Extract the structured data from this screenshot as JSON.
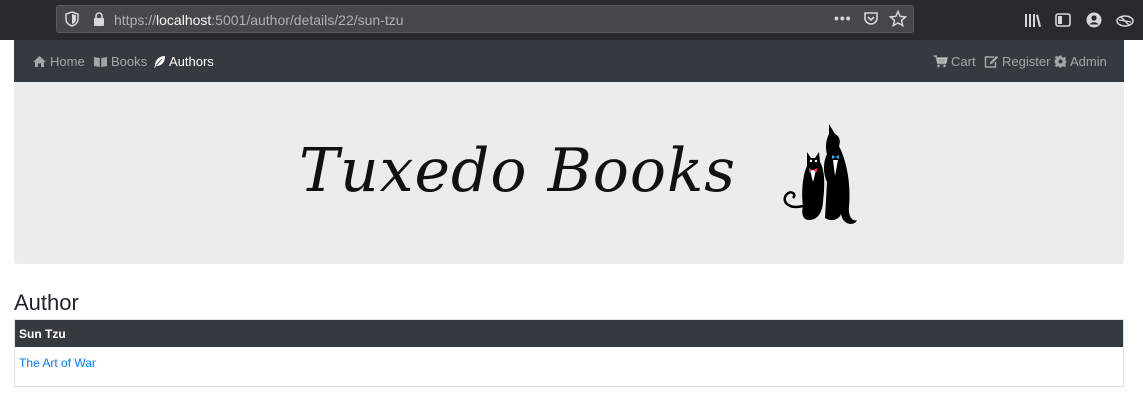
{
  "browser": {
    "url_scheme": "https://",
    "url_host": "localhost",
    "url_path": ":5001/author/details/22/sun-tzu",
    "more_label": "•••"
  },
  "nav": {
    "left": [
      {
        "label": "Home",
        "icon": "home-icon"
      },
      {
        "label": "Books",
        "icon": "book-icon"
      },
      {
        "label": "Authors",
        "icon": "feather-icon",
        "active": true
      }
    ],
    "right": [
      {
        "label": "Cart",
        "icon": "cart-icon"
      },
      {
        "label": "Register",
        "icon": "edit-icon"
      },
      {
        "label": "Admin",
        "icon": "gear-icon"
      }
    ]
  },
  "banner": {
    "logo_text": "Tuxedo Books"
  },
  "main": {
    "heading": "Author",
    "author_name": "Sun Tzu",
    "books": [
      "The Art of War"
    ]
  },
  "colors": {
    "navbar": "#343a40",
    "link": "#007bff",
    "banner": "#ececec"
  }
}
